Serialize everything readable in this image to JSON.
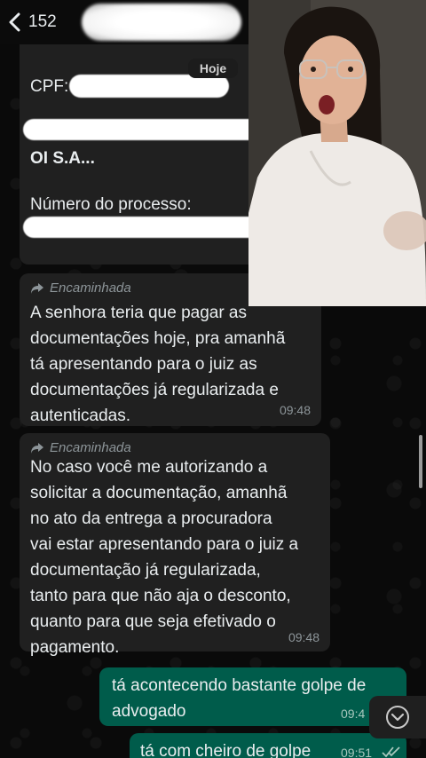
{
  "header": {
    "back_count": "152",
    "icons": [
      "back-chevron-icon",
      "video-call-icon",
      "phone-call-icon"
    ]
  },
  "date_chip": "Hoje",
  "messages": [
    {
      "direction": "in",
      "lines": [
        "CPF:",
        "OI S.A...",
        "Número do processo:"
      ]
    },
    {
      "direction": "in",
      "forwarded_label": "Encaminhada",
      "text_lines": [
        "A senhora teria que pagar as",
        "documentações hoje, pra amanhã",
        "tá apresentando para o juiz as",
        "documentações já regularizada e",
        "autenticadas."
      ],
      "time": "09:48"
    },
    {
      "direction": "in",
      "forwarded_label": "Encaminhada",
      "text_lines": [
        "No caso você me autorizando a",
        "solicitar a documentação, amanhã",
        "no ato da entrega a procuradora",
        "vai estar apresentando para o juiz a",
        "documentação já regularizada,",
        "tanto para que não aja o desconto,",
        "quanto para que seja efetivado o",
        "pagamento."
      ],
      "time": "09:48"
    },
    {
      "direction": "out",
      "text_lines": [
        "tá acontecendo bastante golpe de",
        "advogado"
      ],
      "time": "09:4"
    },
    {
      "direction": "out",
      "text_lines": [
        "tá com cheiro de golpe"
      ],
      "time": "09:51"
    }
  ],
  "colors": {
    "background": "#0b0b0b",
    "incoming_bubble": "#202020",
    "outgoing_bubble": "#005c4b",
    "meta_text": "#8d9599"
  }
}
